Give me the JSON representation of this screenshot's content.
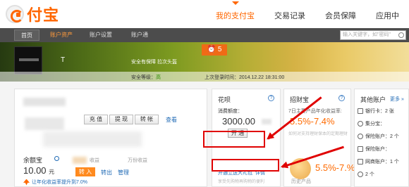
{
  "logo": {
    "text": "付宝"
  },
  "topnav": {
    "items": [
      {
        "label": "我的支付宝"
      },
      {
        "label": "交易记录"
      },
      {
        "label": "会员保障"
      },
      {
        "label": "应用中"
      }
    ]
  },
  "subnav": {
    "tabs": [
      {
        "label": "首页"
      },
      {
        "label": "账户资产"
      },
      {
        "label": "账户设置"
      },
      {
        "label": "账户通"
      }
    ],
    "search_placeholder": "输入关键字，如\"密码\""
  },
  "banner": {
    "account_name": "T",
    "security_text": "安全有保障  拉次头盔",
    "message_count": "5",
    "security_level_label": "安全等级：",
    "security_level_value": "高",
    "last_login": "上次登录时间：2014.12.22 18:31:00"
  },
  "left_panel": {
    "buttons": {
      "recharge": "充 值",
      "withdraw": "提 现",
      "transfer": "转 帐"
    },
    "view_link": "查看",
    "yuebao_label": "余额宝",
    "yuebao_note": "收益",
    "yuebao_note2": "万份收益",
    "yuebao_amount": "10.00",
    "yuebao_unit": "元",
    "in_button": "转 入",
    "out_link": "转出",
    "manage_link": "管理",
    "promo_text": "让年化收益率提升到7.0%"
  },
  "huabei": {
    "title": "花呗",
    "help": "?",
    "quota_label": "消费额度：",
    "quota_amount": "3000.00",
    "open_button": "开 通",
    "invite_text": "开通立送大礼包",
    "detail_link": "详情",
    "small_text": "享受先购物再购物的便利"
  },
  "zhaocaibao": {
    "title": "招财宝",
    "help": "?",
    "desc": "7日主要产品年化收益率:",
    "rate": "5.5%-7.4%",
    "small_text": "如何对支持理财保本的定期理财",
    "rate2": "5.5%-7.%",
    "history": "历史产品"
  },
  "other": {
    "title": "其他账户",
    "more": "更多 »",
    "items": [
      {
        "label": "银行卡：2 张",
        "value": ""
      },
      {
        "label": "集分宝：",
        "value": ""
      },
      {
        "label": "保险账户：2 个",
        "value": ""
      },
      {
        "label": "保险账户：",
        "value": ""
      },
      {
        "label": "网商账户：1 个",
        "value": ""
      },
      {
        "label": "",
        "value": "2 个"
      }
    ]
  }
}
